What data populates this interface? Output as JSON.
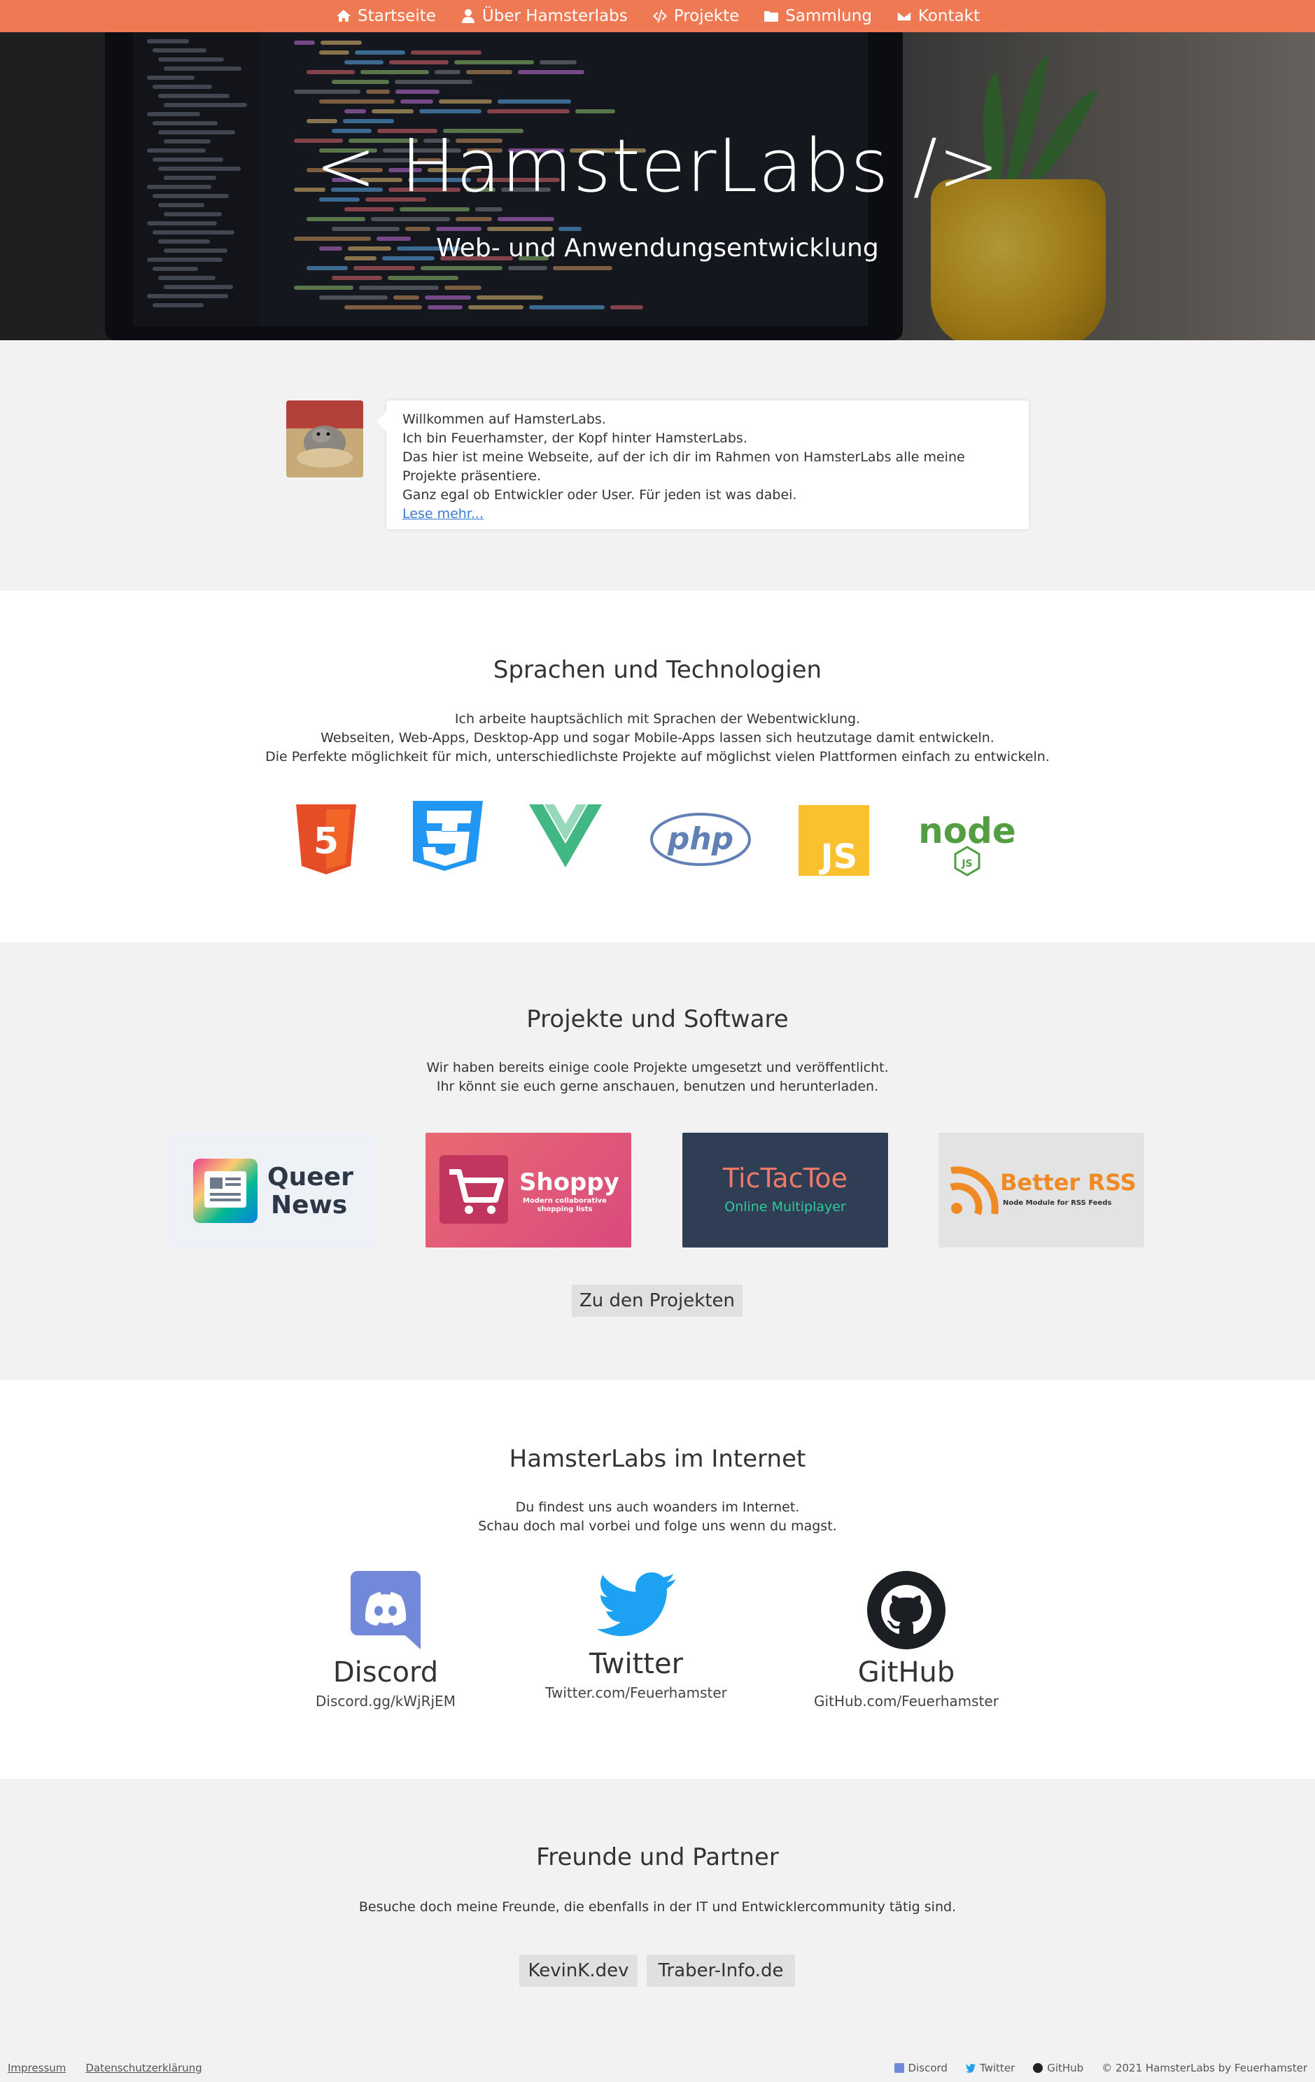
{
  "nav": {
    "items": [
      {
        "label": "Startseite",
        "icon": "home-icon"
      },
      {
        "label": "Über Hamsterlabs",
        "icon": "user-icon"
      },
      {
        "label": "Projekte",
        "icon": "code-icon"
      },
      {
        "label": "Sammlung",
        "icon": "folder-icon"
      },
      {
        "label": "Kontakt",
        "icon": "envelope-icon"
      }
    ]
  },
  "hero": {
    "title": "< HamsterLabs />",
    "subtitle": "Web- und Anwendungsentwicklung"
  },
  "welcome": {
    "lines": [
      "Willkommen auf HamsterLabs.",
      "Ich bin Feuerhamster, der Kopf hinter HamsterLabs.",
      "Das hier ist meine Webseite, auf der ich dir im Rahmen von HamsterLabs alle meine Projekte präsentiere.",
      "Ganz egal ob Entwickler oder User. Für jeden ist was dabei."
    ],
    "more": "Lese mehr..."
  },
  "tech": {
    "title": "Sprachen und Technologien",
    "lines": [
      "Ich arbeite hauptsächlich mit Sprachen der Webentwicklung.",
      "Webseiten, Web-Apps, Desktop-App und sogar Mobile-Apps lassen sich heutzutage damit entwickeln.",
      "Die Perfekte möglichkeit für mich, unterschiedlichste Projekte auf möglichst vielen Plattformen einfach zu entwickeln."
    ],
    "logos": {
      "html5": "5",
      "css3": "3",
      "php": "php",
      "js": "JS",
      "node": "node",
      "node_badge": "JS"
    },
    "colors": {
      "html5": "#e44d26",
      "css3": "#1572b6",
      "vue": "#41b883",
      "vue_dark": "#35495e",
      "php": "#6181b6",
      "js": "#f7df1e",
      "node": "#539e43"
    }
  },
  "projects": {
    "title": "Projekte und Software",
    "lines": [
      "Wir haben bereits einige coole Projekte umgesetzt und veröffentlicht.",
      "Ihr könnt sie euch gerne anschauen, benutzen und herunterladen."
    ],
    "cards": [
      {
        "title_line1": "Queer",
        "title_line2": "News"
      },
      {
        "title": "Shoppy",
        "subtitle": "Modern collaborative shopping lists"
      },
      {
        "title": "TicTacToe",
        "subtitle": "Online Multiplayer"
      },
      {
        "title": "Better RSS",
        "subtitle": "Node Module for RSS Feeds"
      }
    ],
    "button": "Zu den Projekten"
  },
  "internet": {
    "title": "HamsterLabs im Internet",
    "lines": [
      "Du findest uns auch woanders im Internet.",
      "Schau doch mal vorbei und folge uns wenn du magst."
    ],
    "socials": [
      {
        "name": "Discord",
        "link": "Discord.gg/kWjRjEM"
      },
      {
        "name": "Twitter",
        "link": "Twitter.com/Feuerhamster"
      },
      {
        "name": "GitHub",
        "link": "GitHub.com/Feuerhamster"
      }
    ]
  },
  "friends": {
    "title": "Freunde und Partner",
    "text": "Besuche doch meine Freunde, die ebenfalls in der IT und Entwicklercommunity tätig sind.",
    "buttons": [
      "KevinK.dev",
      "Traber-Info.de"
    ]
  },
  "footer": {
    "impressum": "Impressum",
    "privacy": "Datenschutzerklärung",
    "discord": "Discord",
    "twitter": "Twitter",
    "github": "GitHub",
    "copyright": "© 2021 HamsterLabs by Feuerhamster"
  }
}
